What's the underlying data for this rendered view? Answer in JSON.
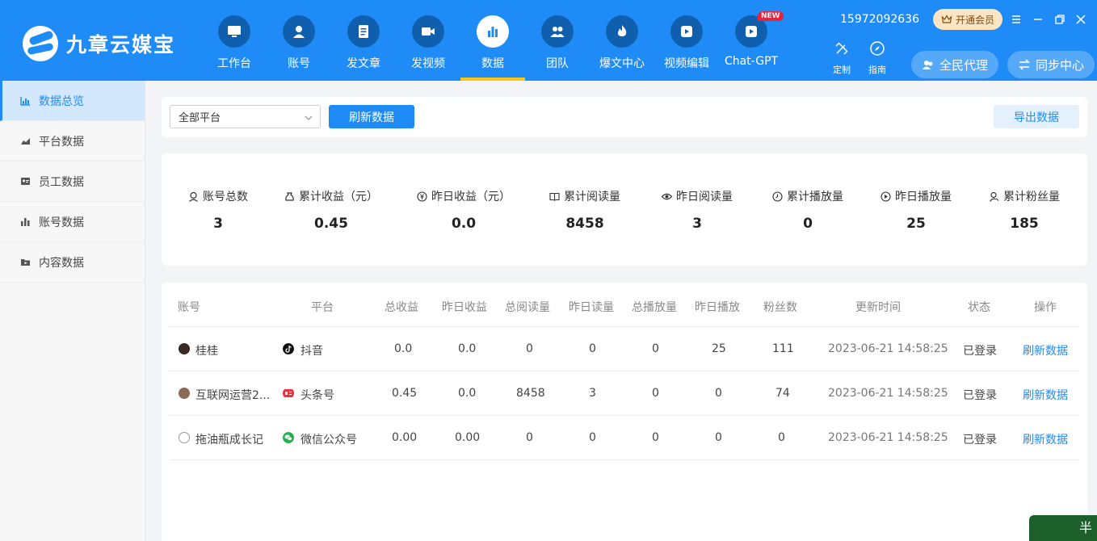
{
  "app": {
    "name": "九章云媒宝"
  },
  "colors": {
    "primary": "#1e8bf7",
    "nav_active_underline": "#f5c518",
    "vip_bg": "#fde5c4"
  },
  "nav": {
    "items": [
      {
        "label": "工作台",
        "icon": "monitor-icon"
      },
      {
        "label": "账号",
        "icon": "user-icon"
      },
      {
        "label": "发文章",
        "icon": "document-icon"
      },
      {
        "label": "发视频",
        "icon": "video-camera-icon"
      },
      {
        "label": "数据",
        "icon": "bar-chart-icon",
        "active": true
      },
      {
        "label": "团队",
        "icon": "team-icon"
      },
      {
        "label": "爆文中心",
        "icon": "fire-icon"
      },
      {
        "label": "视频编辑",
        "icon": "video-edit-icon"
      },
      {
        "label": "Chat-GPT",
        "icon": "chat-gpt-icon",
        "badge": "NEW"
      }
    ]
  },
  "header": {
    "phone": "15972092636",
    "vip_label": "开通会员",
    "tools": [
      {
        "label": "定制",
        "icon": "customize-icon"
      },
      {
        "label": "指南",
        "icon": "compass-icon"
      }
    ],
    "agent_label": "全民代理",
    "sync_label": "同步中心"
  },
  "sidebar": {
    "items": [
      {
        "label": "数据总览",
        "icon": "overview-chart-icon",
        "active": true
      },
      {
        "label": "平台数据",
        "icon": "area-chart-icon"
      },
      {
        "label": "员工数据",
        "icon": "id-card-icon"
      },
      {
        "label": "账号数据",
        "icon": "bar-chart-small-icon"
      },
      {
        "label": "内容数据",
        "icon": "folder-play-icon"
      }
    ]
  },
  "toolbar": {
    "platform_select": "全部平台",
    "refresh_label": "刷新数据",
    "export_label": "导出数据"
  },
  "stats": [
    {
      "label": "账号总数",
      "value": "3",
      "icon": "account-icon"
    },
    {
      "label": "累计收益（元）",
      "value": "0.45",
      "icon": "money-bag-icon"
    },
    {
      "label": "昨日收益（元）",
      "value": "0.0",
      "icon": "yen-icon"
    },
    {
      "label": "累计阅读量",
      "value": "8458",
      "icon": "book-open-icon"
    },
    {
      "label": "昨日阅读量",
      "value": "3",
      "icon": "eye-icon"
    },
    {
      "label": "累计播放量",
      "value": "0",
      "icon": "clock-icon"
    },
    {
      "label": "昨日播放量",
      "value": "25",
      "icon": "play-circle-icon"
    },
    {
      "label": "累计粉丝量",
      "value": "185",
      "icon": "followers-icon"
    }
  ],
  "table": {
    "headers": [
      "账号",
      "平台",
      "总收益",
      "昨日收益",
      "总阅读量",
      "昨日读量",
      "总播放量",
      "昨日播放",
      "粉丝数",
      "更新时间",
      "状态",
      "操作"
    ],
    "rows": [
      {
        "account": "桂桂",
        "platform": "抖音",
        "platform_icon": "douyin-icon",
        "total_income": "0.0",
        "yesterday_income": "0.0",
        "total_reads": "0",
        "yesterday_reads": "0",
        "total_plays": "0",
        "yesterday_plays": "25",
        "fans": "111",
        "updated": "2023-06-21 14:58:25",
        "status": "已登录",
        "action": "刷新数据"
      },
      {
        "account": "互联网运营2...",
        "platform": "头条号",
        "platform_icon": "toutiao-icon",
        "total_income": "0.45",
        "yesterday_income": "0.0",
        "total_reads": "8458",
        "yesterday_reads": "3",
        "total_plays": "0",
        "yesterday_plays": "0",
        "fans": "74",
        "updated": "2023-06-21 14:58:25",
        "status": "已登录",
        "action": "刷新数据"
      },
      {
        "account": "拖油瓶成长记",
        "platform": "微信公众号",
        "platform_icon": "wechat-icon",
        "total_income": "0.00",
        "yesterday_income": "0.00",
        "total_reads": "0",
        "yesterday_reads": "0",
        "total_plays": "0",
        "yesterday_plays": "0",
        "fans": "0",
        "updated": "2023-06-21 14:58:25",
        "status": "已登录",
        "action": "刷新数据"
      }
    ]
  },
  "corner": {
    "text": "半"
  }
}
